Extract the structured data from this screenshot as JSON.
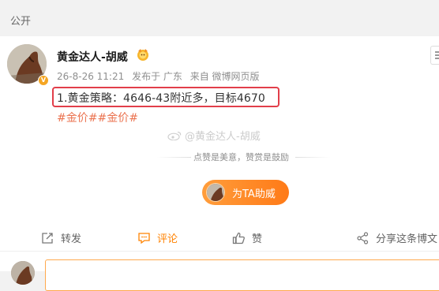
{
  "header": {
    "visibility": "公开"
  },
  "post": {
    "author": "黄金达人-胡威",
    "timestamp": "26-8-26 11:21",
    "location": "发布于 广东",
    "source": "来自 微博网页版",
    "text": "1.黄金策略：4646-43附近多，目标4670",
    "hashtags": "#金价##金价#",
    "watermark": "@黄金达人-胡威"
  },
  "reward": {
    "slogan": "点赞是美意，赞赏是鼓励",
    "button_label": "为TA助威"
  },
  "actions": {
    "forward": "转发",
    "comment": "评论",
    "like": "赞",
    "share": "分享这条博文"
  },
  "colors": {
    "highlight_border": "#e23e4a",
    "hashtag": "#eb7350",
    "accent": "#ff8200",
    "reward_button": "#ff8a24"
  },
  "icons": [
    "more-icon",
    "verified-icon",
    "rank-badge-icon",
    "weibo-logo-icon",
    "forward-icon",
    "comment-icon",
    "like-icon",
    "share-icon"
  ]
}
